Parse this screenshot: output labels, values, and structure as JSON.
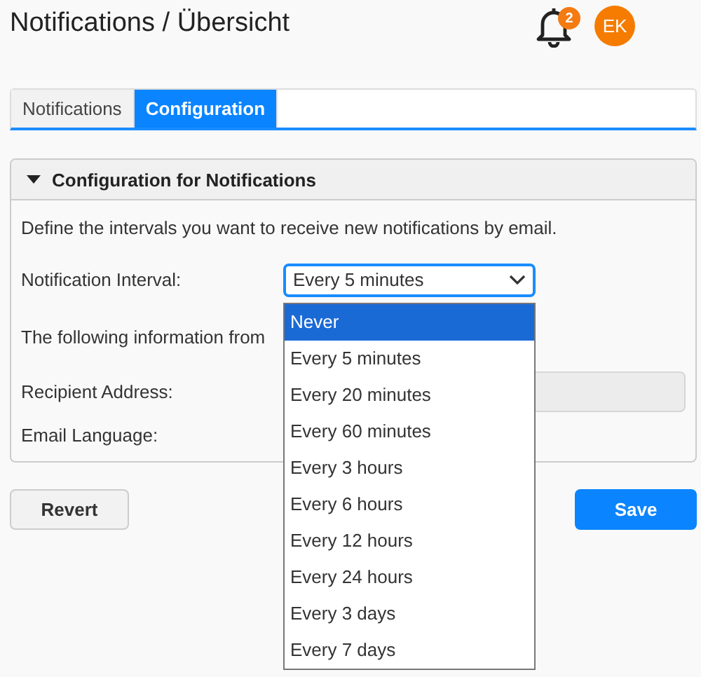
{
  "header": {
    "title": "Notifications / Übersicht",
    "badge": "2",
    "avatar": "EK"
  },
  "tabs": [
    {
      "label": "Notifications",
      "selected": false
    },
    {
      "label": "Configuration",
      "selected": true
    }
  ],
  "panel": {
    "title": "Configuration for Notifications",
    "expanded": true,
    "description": "Define the intervals you want to receive new notifications by email.",
    "interval_label": "Notification Interval:",
    "interval_value": "Every 5 minutes",
    "info_text": "The following information from",
    "recipient_label": "Recipient Address:",
    "language_label": "Email Language:"
  },
  "dropdown": [
    {
      "label": "Never",
      "selected": true
    },
    {
      "label": "Every 5 minutes",
      "selected": false
    },
    {
      "label": "Every 20 minutes",
      "selected": false
    },
    {
      "label": "Every 60 minutes",
      "selected": false
    },
    {
      "label": "Every 3 hours",
      "selected": false
    },
    {
      "label": "Every 6 hours",
      "selected": false
    },
    {
      "label": "Every 12 hours",
      "selected": false
    },
    {
      "label": "Every 24 hours",
      "selected": false
    },
    {
      "label": "Every 3 days",
      "selected": false
    },
    {
      "label": "Every 7 days",
      "selected": false
    }
  ],
  "buttons": {
    "revert": "Revert",
    "save": "Save"
  }
}
